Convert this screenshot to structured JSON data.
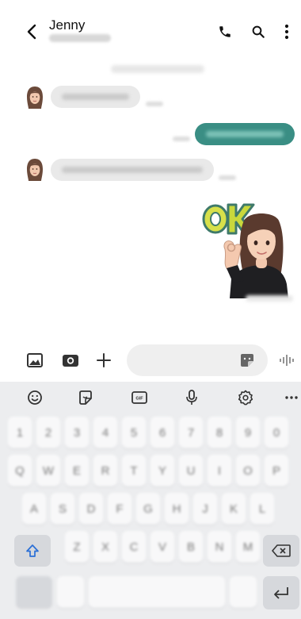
{
  "header": {
    "contact_name": "Jenny",
    "icons": {
      "back": "chevron-left-icon",
      "call": "phone-icon",
      "search": "search-icon",
      "more": "more-vertical-icon"
    }
  },
  "conversation": {
    "accent_color": "#3a8e84",
    "messages": [
      {
        "direction": "incoming",
        "type": "text"
      },
      {
        "direction": "outgoing",
        "type": "text"
      },
      {
        "direction": "incoming",
        "type": "text"
      },
      {
        "direction": "outgoing",
        "type": "sticker",
        "sticker_text": "OK"
      }
    ]
  },
  "compose": {
    "message_value": "",
    "icons": {
      "gallery": "image-icon",
      "camera": "camera-icon",
      "attach": "plus-icon",
      "sticker": "sticker-icon",
      "voice": "voice-waveform-icon"
    }
  },
  "keyboard": {
    "toolbar_icons": [
      "emoji-icon",
      "sticker-icon",
      "gif-icon",
      "microphone-icon",
      "settings-icon",
      "more-horizontal-icon"
    ],
    "gif_label": "GIF",
    "rows": [
      [
        "1",
        "2",
        "3",
        "4",
        "5",
        "6",
        "7",
        "8",
        "9",
        "0"
      ],
      [
        "Q",
        "W",
        "E",
        "R",
        "T",
        "Y",
        "U",
        "I",
        "O",
        "P"
      ],
      [
        "A",
        "S",
        "D",
        "F",
        "G",
        "H",
        "J",
        "K",
        "L"
      ],
      [
        "Z",
        "X",
        "C",
        "V",
        "B",
        "N",
        "M"
      ]
    ]
  }
}
